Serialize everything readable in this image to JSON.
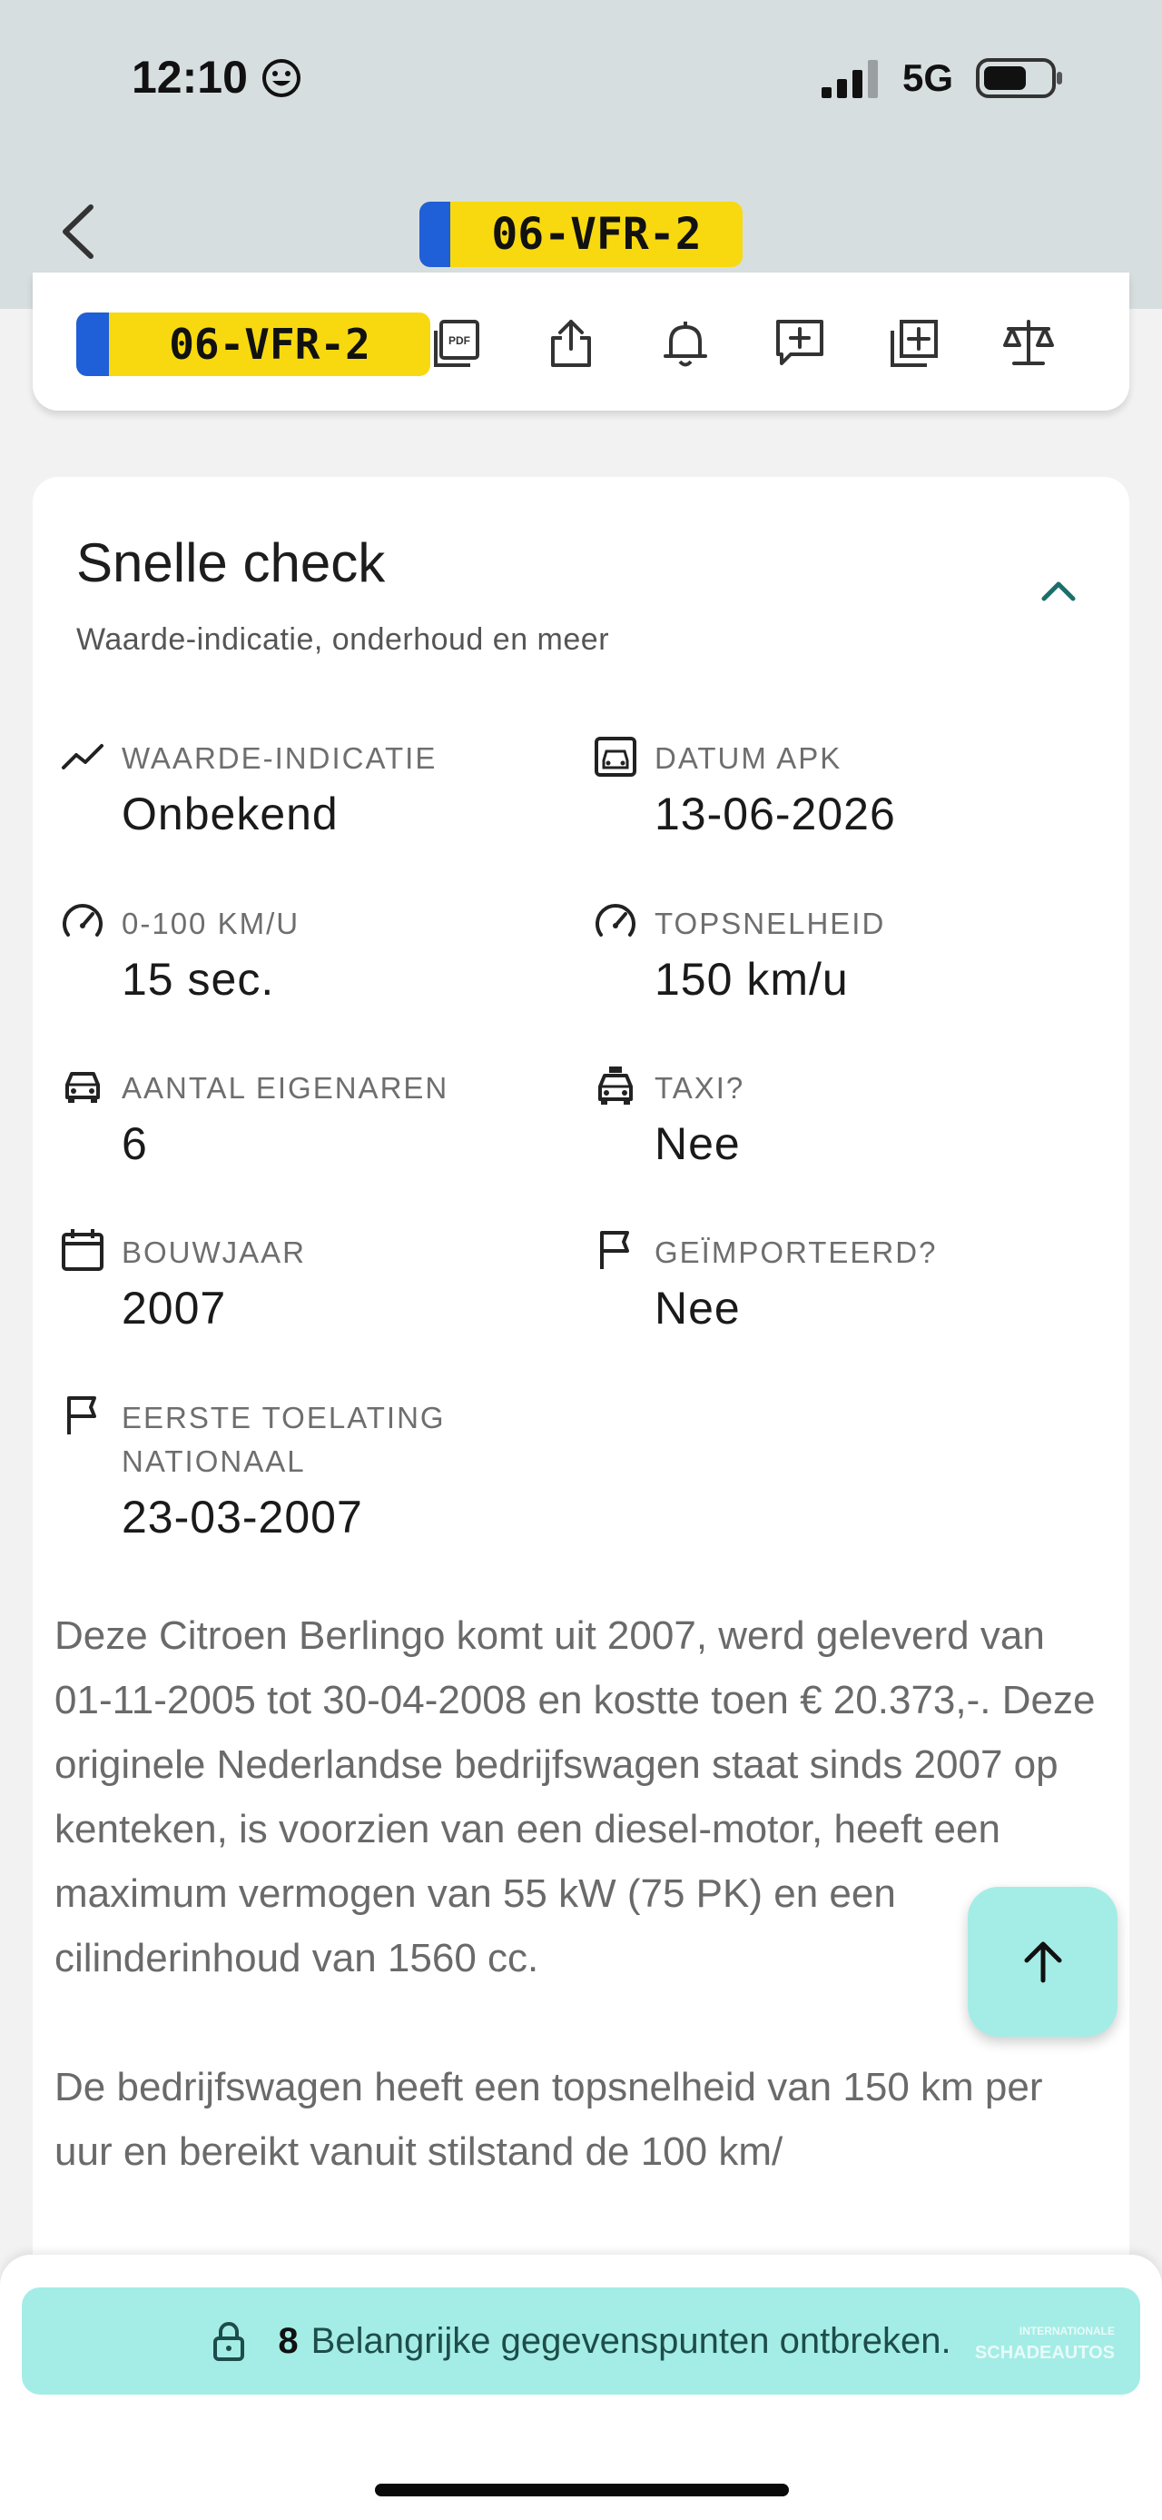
{
  "status_bar": {
    "time": "12:10",
    "network": "5G"
  },
  "header": {
    "plate": "06-VFR-2"
  },
  "toolbar": {
    "plate": "06-VFR-2",
    "icons": [
      "pdf-icon",
      "share-icon",
      "bell-icon",
      "add-comment-icon",
      "add-box-icon",
      "compare-icon"
    ]
  },
  "quick_check": {
    "title": "Snelle check",
    "subtitle": "Waarde-indicatie, onderhoud en meer",
    "stats": [
      {
        "icon": "trend-icon",
        "label": "WAARDE-INDICATIE",
        "value": "Onbekend"
      },
      {
        "icon": "garage-icon",
        "label": "DATUM APK",
        "value": "13-06-2026"
      },
      {
        "icon": "speedometer-icon",
        "label": "0-100 KM/U",
        "value": "15 sec."
      },
      {
        "icon": "speedometer-icon",
        "label": "TOPSNELHEID",
        "value": "150 km/u"
      },
      {
        "icon": "car-icon",
        "label": "AANTAL EIGENAREN",
        "value": "6"
      },
      {
        "icon": "taxi-icon",
        "label": "TAXI?",
        "value": "Nee"
      },
      {
        "icon": "calendar-icon",
        "label": "BOUWJAAR",
        "value": "2007"
      },
      {
        "icon": "flag-icon",
        "label": "GEÏMPORTEERD?",
        "value": "Nee"
      },
      {
        "icon": "flag-icon",
        "label": "EERSTE TOELATING NATIONAAL",
        "value": "23-03-2007"
      }
    ],
    "description": [
      "Deze Citroen Berlingo komt uit 2007, werd geleverd van 01-11-2005 tot 30-04-2008 en kostte toen € 20.373,-. Deze originele Nederlandse bedrijfswagen staat sinds 2007 op kenteken, is voorzien van een diesel-motor, heeft een maximum vermogen van 55 kW (75 PK) en een cilinderinhoud van 1560 cc.",
      "De bedrijfswagen heeft een topsnelheid van 150 km per uur en bereikt vanuit stilstand de 100 km/"
    ]
  },
  "bottom_banner": {
    "count": "8",
    "text": "Belangrijke gegevenspunten ontbreken.",
    "watermark_line1": "INTERNATIONALE",
    "watermark_line2": "SCHADEAUTOS"
  },
  "colors": {
    "accent": "#a4ede6",
    "plate_yellow": "#f8d90f",
    "plate_blue": "#1f5fd7",
    "chevron": "#1b6f69"
  }
}
